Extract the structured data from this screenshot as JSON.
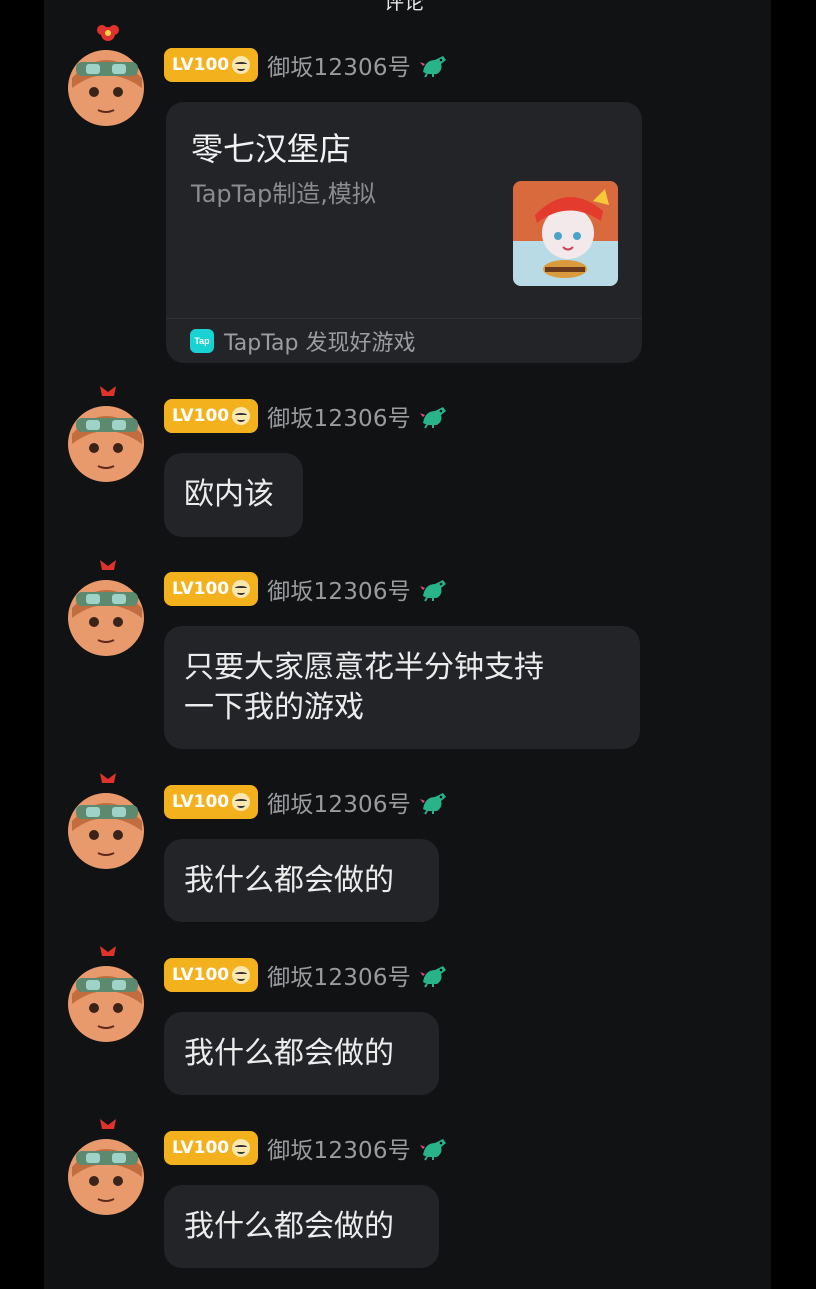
{
  "top_peek_text": "评论",
  "user": {
    "level": "LV100",
    "name": "御坂12306号"
  },
  "messages": [
    {
      "type": "card",
      "title": "零七汉堡店",
      "subtitle": "TapTap制造,模拟",
      "footer": "TapTap 发现好游戏",
      "icon_label": "Tap"
    },
    {
      "type": "text",
      "lines": [
        "欧内该"
      ]
    },
    {
      "type": "text",
      "lines": [
        "只要大家愿意花半分钟支持",
        "一下我的游戏"
      ]
    },
    {
      "type": "text",
      "lines": [
        "我什么都会做的"
      ]
    },
    {
      "type": "text",
      "lines": [
        "我什么都会做的"
      ]
    },
    {
      "type": "text",
      "lines": [
        "我什么都会做的"
      ]
    }
  ],
  "colors": {
    "page_bg": "#000000",
    "chat_bg": "#111213",
    "bubble_bg": "#222428",
    "level_badge": "#f3b21d",
    "taptap_accent": "#19d3d3"
  }
}
